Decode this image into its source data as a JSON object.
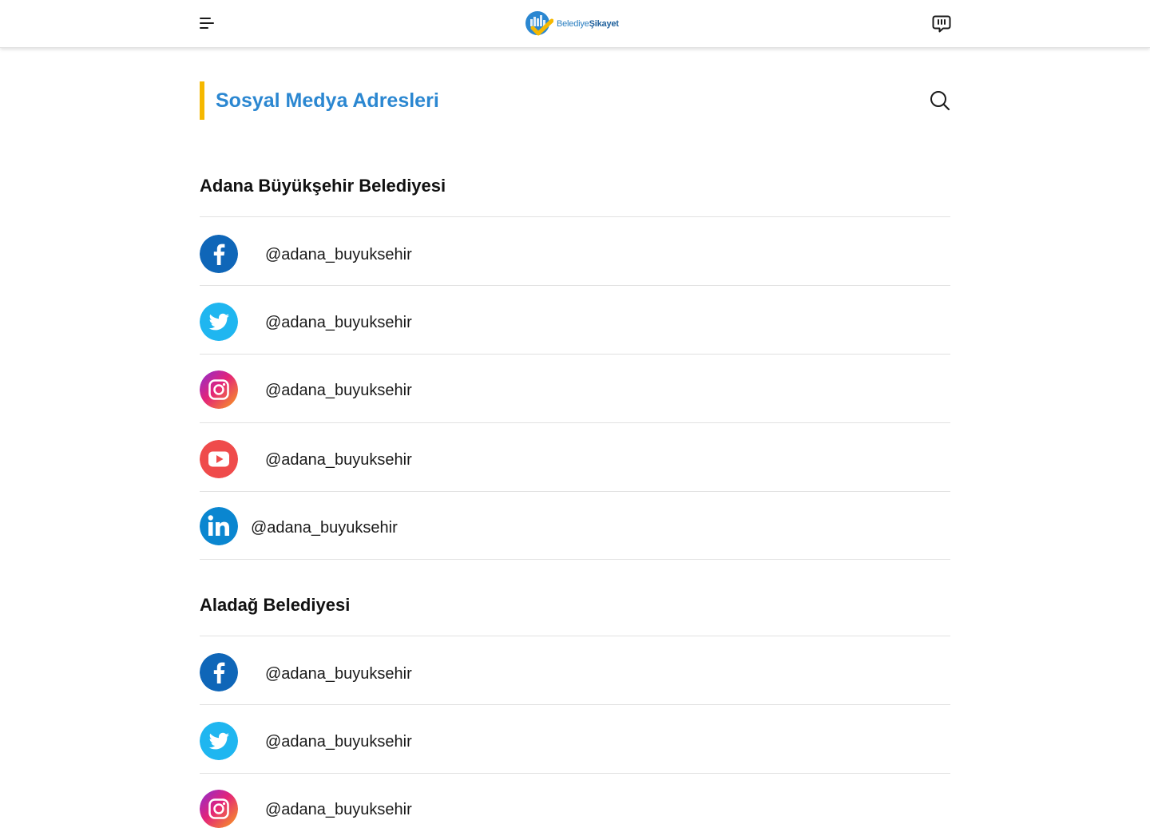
{
  "header": {
    "brand_part1": "Belediye",
    "brand_part2": "Şikayet",
    "menu_icon": "hamburger-menu-icon",
    "feedback_icon": "feedback-chat-icon"
  },
  "page": {
    "title": "Sosyal Medya Adresleri",
    "search_icon": "search-icon",
    "accent_color": "#f5b800",
    "title_color": "#2b87d1"
  },
  "sections": [
    {
      "title": "Adana Büyükşehir Belediyesi",
      "links": [
        {
          "network": "facebook",
          "icon": "facebook-icon",
          "handle": "@adana_buyuksehir"
        },
        {
          "network": "twitter",
          "icon": "twitter-icon",
          "handle": "@adana_buyuksehir"
        },
        {
          "network": "instagram",
          "icon": "instagram-icon",
          "handle": "@adana_buyuksehir"
        },
        {
          "network": "youtube",
          "icon": "youtube-icon",
          "handle": "@adana_buyuksehir"
        },
        {
          "network": "linkedin",
          "icon": "linkedin-icon",
          "handle": "@adana_buyuksehir"
        }
      ]
    },
    {
      "title": "Aladağ Belediyesi",
      "links": [
        {
          "network": "facebook",
          "icon": "facebook-icon",
          "handle": "@adana_buyuksehir"
        },
        {
          "network": "twitter",
          "icon": "twitter-icon",
          "handle": "@adana_buyuksehir"
        },
        {
          "network": "instagram",
          "icon": "instagram-icon",
          "handle": "@adana_buyuksehir"
        }
      ]
    }
  ],
  "colors": {
    "facebook": "#0f66b8",
    "twitter": "#1fb6f0",
    "youtube": "#ef4b4b",
    "linkedin": "#0a86d0"
  }
}
